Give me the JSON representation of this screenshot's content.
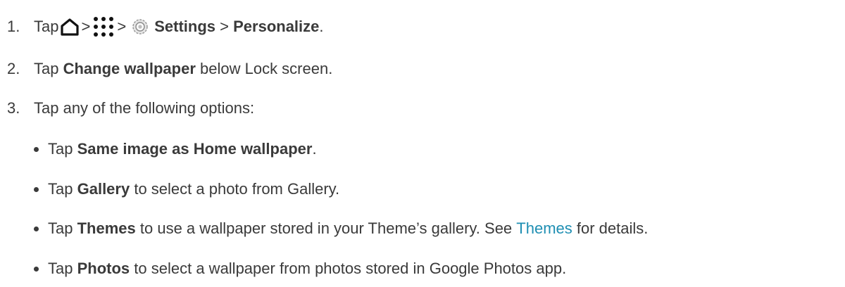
{
  "steps": [
    {
      "number": "1.",
      "tap": "Tap",
      "sep1": ">",
      "sep2": ">",
      "settings": "Settings",
      "sep3": ">",
      "personalize": "Personalize",
      "period": "."
    },
    {
      "number": "2.",
      "tap": "Tap",
      "bold": "Change wallpaper",
      "rest": " below Lock screen."
    },
    {
      "number": "3.",
      "text": "Tap any of the following options:"
    }
  ],
  "options": [
    {
      "tap": "Tap",
      "bold": "Same image as Home wallpaper",
      "rest": "."
    },
    {
      "tap": "Tap",
      "bold": "Gallery",
      "rest": " to select a photo from Gallery."
    },
    {
      "tap": "Tap",
      "bold": "Themes",
      "rest": " to use a wallpaper stored in your Theme’s gallery. See ",
      "link": "Themes",
      "rest2": " for details."
    },
    {
      "tap": "Tap",
      "bold": "Photos",
      "rest": " to select a wallpaper from photos stored in Google Photos app."
    }
  ],
  "colors": {
    "text": "#3a3a3a",
    "link": "#1f8fb3"
  },
  "icons": [
    "home-icon",
    "apps-grid-icon",
    "settings-gear-icon"
  ]
}
